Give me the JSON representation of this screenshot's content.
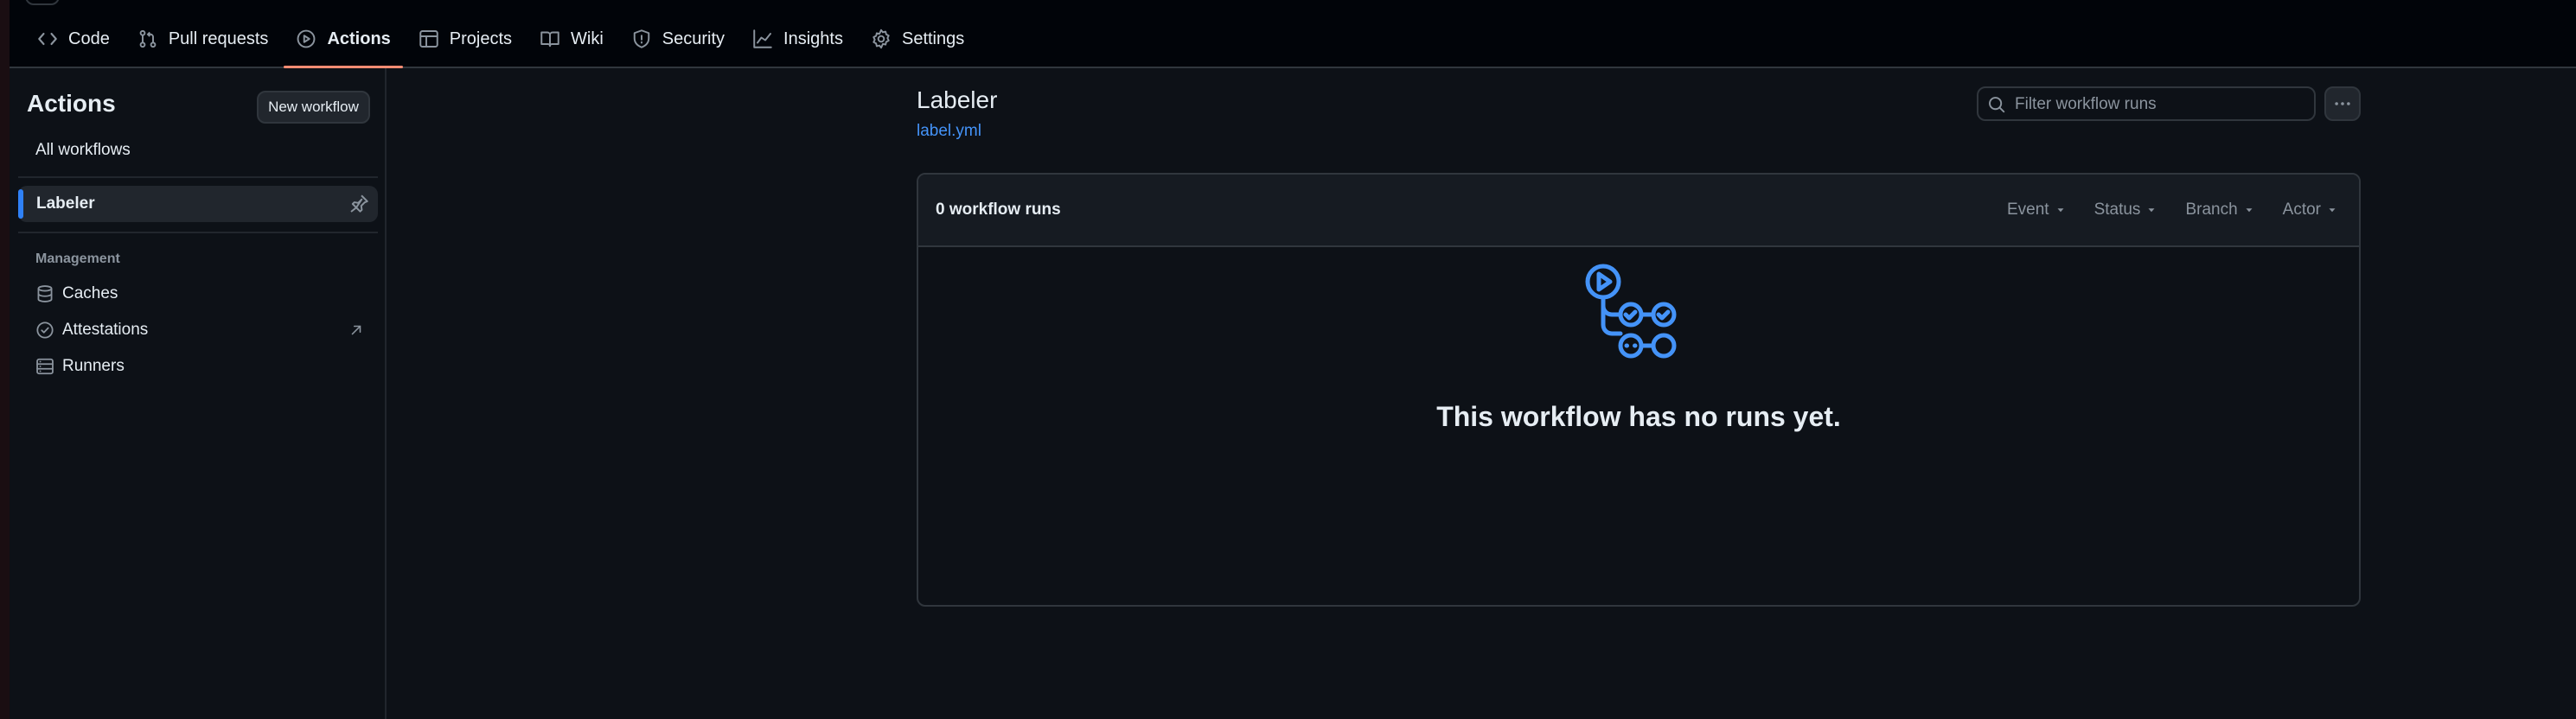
{
  "nav": {
    "items": [
      {
        "label": "Code",
        "icon": "code-icon",
        "active": false
      },
      {
        "label": "Pull requests",
        "icon": "git-pull-request-icon",
        "active": false
      },
      {
        "label": "Actions",
        "icon": "play-icon",
        "active": true
      },
      {
        "label": "Projects",
        "icon": "table-icon",
        "active": false
      },
      {
        "label": "Wiki",
        "icon": "book-icon",
        "active": false
      },
      {
        "label": "Security",
        "icon": "shield-icon",
        "active": false
      },
      {
        "label": "Insights",
        "icon": "graph-icon",
        "active": false
      },
      {
        "label": "Settings",
        "icon": "gear-icon",
        "active": false
      }
    ]
  },
  "sidebar": {
    "title": "Actions",
    "new_workflow_label": "New workflow",
    "all_workflows_label": "All workflows",
    "selected_workflow": "Labeler",
    "management_heading": "Management",
    "management_items": [
      {
        "label": "Caches",
        "icon": "database-icon"
      },
      {
        "label": "Attestations",
        "icon": "verified-icon"
      },
      {
        "label": "Runners",
        "icon": "server-icon"
      }
    ]
  },
  "main": {
    "workflow_name": "Labeler",
    "workflow_file": "label.yml",
    "filter_placeholder": "Filter workflow runs",
    "runs_count": "0 workflow runs",
    "filters": [
      "Event",
      "Status",
      "Branch",
      "Actor"
    ],
    "blankslate_text": "This workflow has no runs yet."
  },
  "colors": {
    "background": "#0d1117",
    "header": "#010409",
    "accent": "#2f81f7",
    "active_underline": "#fd8c73",
    "link": "#4493f8"
  }
}
